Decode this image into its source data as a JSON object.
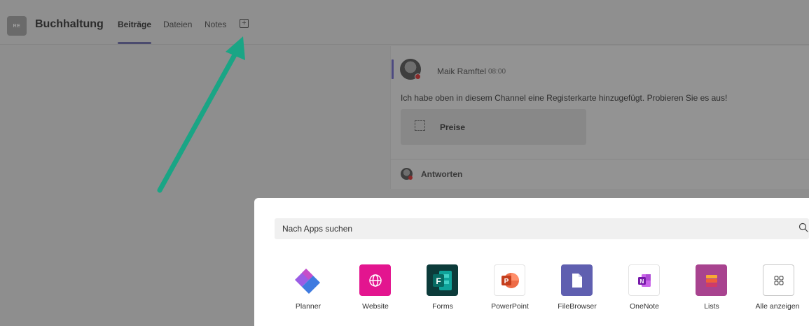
{
  "header": {
    "team_initials": "RE",
    "channel_title": "Buchhaltung",
    "tabs": [
      {
        "label": "Beiträge",
        "active": true
      },
      {
        "label": "Dateien",
        "active": false
      },
      {
        "label": "Notes",
        "active": false
      }
    ],
    "add_tab_icon": "plus-square-icon"
  },
  "post": {
    "author": "Maik Ramftel",
    "time": "08:00",
    "text": "Ich habe oben in diesem Channel eine Registerkarte hinzugefügt. Probieren Sie es aus!",
    "attachment_label": "Preise",
    "reply_label": "Antworten"
  },
  "annotation": {
    "arrow_color": "#1aa585"
  },
  "app_picker": {
    "search_placeholder": "Nach Apps suchen",
    "apps": [
      {
        "label": "Planner",
        "icon": "planner-icon",
        "color": "#7b4fd8"
      },
      {
        "label": "Website",
        "icon": "globe-icon",
        "color": "#e3158f"
      },
      {
        "label": "Forms",
        "icon": "forms-icon",
        "color": "#087a6e"
      },
      {
        "label": "PowerPoint",
        "icon": "powerpoint-icon",
        "color": "#d24726"
      },
      {
        "label": "FileBrowser",
        "icon": "file-icon",
        "color": "#5f5fb0"
      },
      {
        "label": "OneNote",
        "icon": "onenote-icon",
        "color": "#7719aa"
      },
      {
        "label": "Lists",
        "icon": "lists-icon",
        "color": "#b4479c"
      },
      {
        "label": "Alle anzeigen",
        "icon": "grid-icon",
        "color": "#ffffff"
      }
    ]
  }
}
